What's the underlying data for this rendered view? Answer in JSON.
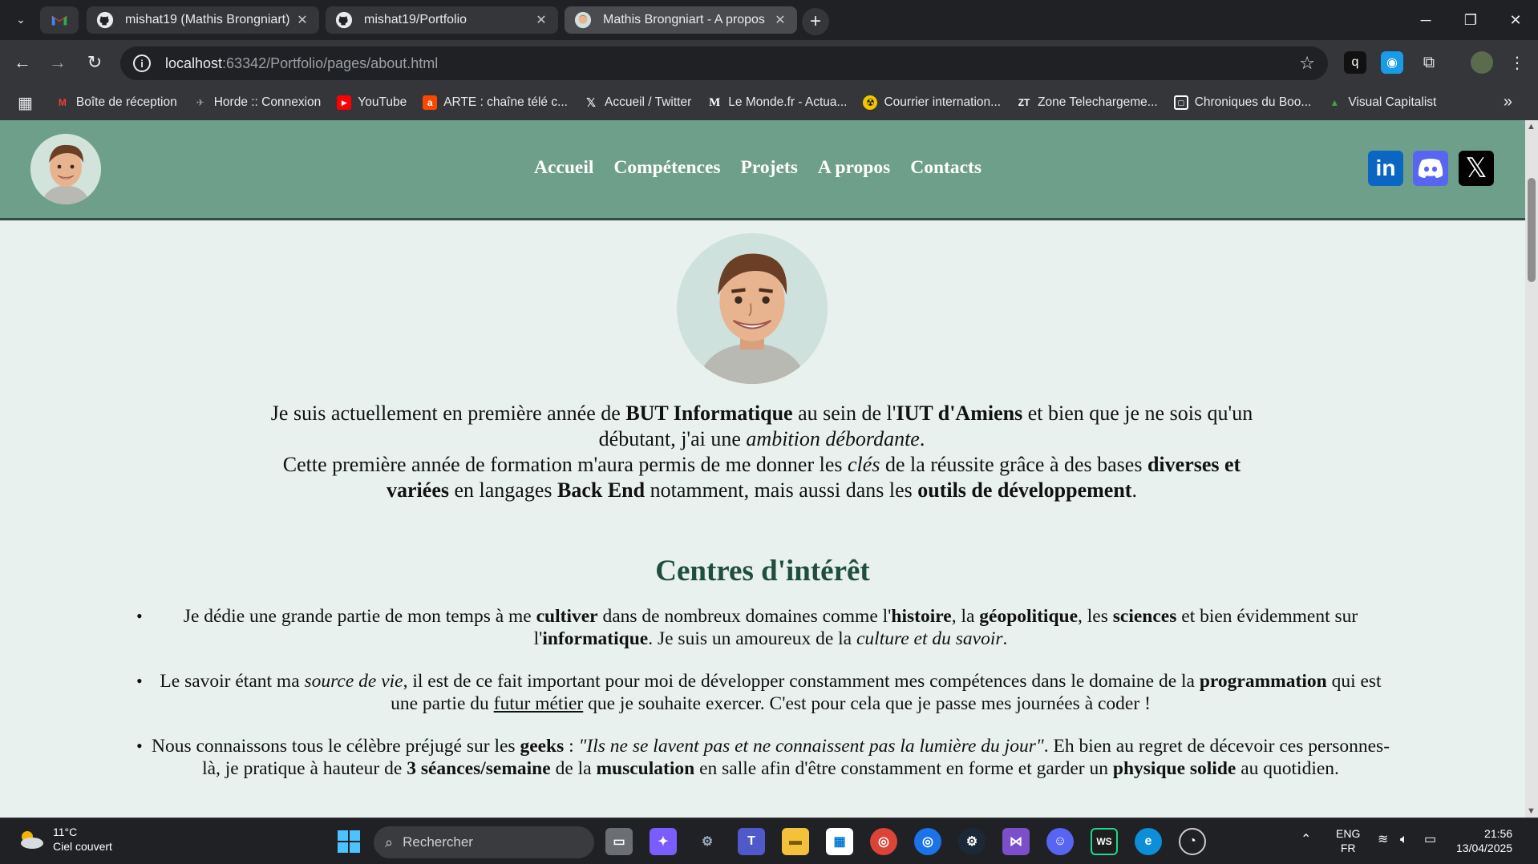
{
  "browser": {
    "tabs": [
      {
        "title": "mishat19 (Mathis Brongniart)",
        "close": "✕"
      },
      {
        "title": "mishat19/Portfolio",
        "close": "✕"
      },
      {
        "title": "Mathis Brongniart - A propos",
        "close": "✕"
      }
    ],
    "new_tab": "+",
    "url_host": "localhost",
    "url_path": ":63342/Portfolio/pages/about.html",
    "bookmarks": [
      {
        "label": "Boîte de réception",
        "icon": "gmail-icon",
        "color": "#ea4335"
      },
      {
        "label": "Horde :: Connexion",
        "icon": "horde-icon",
        "color": "#9aa0a6"
      },
      {
        "label": "YouTube",
        "icon": "youtube-icon",
        "color": "#ff0000"
      },
      {
        "label": "ARTE : chaîne télé c...",
        "icon": "arte-icon",
        "color": "#fd4600"
      },
      {
        "label": "Accueil / Twitter",
        "icon": "x-icon",
        "color": "#000000"
      },
      {
        "label": "Le Monde.fr - Actua...",
        "icon": "lemonde-icon",
        "color": "#000000"
      },
      {
        "label": "Courrier internation...",
        "icon": "courrier-icon",
        "color": "#f5c400"
      },
      {
        "label": "Zone Telechargeme...",
        "icon": "zt-icon",
        "color": "#35363a"
      },
      {
        "label": "Chroniques du Boo...",
        "icon": "chroniques-icon",
        "color": "#35363a"
      },
      {
        "label": "Visual Capitalist",
        "icon": "visualcapitalist-icon",
        "color": "#3fa14a"
      }
    ]
  },
  "site": {
    "nav": [
      "Accueil",
      "Compétences",
      "Projets",
      "A propos",
      "Contacts"
    ],
    "social": {
      "linkedin": "in",
      "x": "𝕏"
    },
    "intro": {
      "p1_a": "Je suis actuellement en première année de ",
      "p1_b": "BUT Informatique",
      "p1_c": " au sein de l'",
      "p1_d": "IUT d'Amiens",
      "p1_e": " et bien que je ne sois qu'un débutant, j'ai une ",
      "p1_f": "ambition débordante",
      "p1_g": ".",
      "p2_a": "Cette première année de formation m'aura permis de me donner les ",
      "p2_b": "clés",
      "p2_c": " de la réussite grâce à des bases ",
      "p2_d": "diverses et variées",
      "p2_e": " en langages ",
      "p2_f": "Back End",
      "p2_g": " notamment, mais aussi dans les ",
      "p2_h": "outils de développement",
      "p2_i": "."
    },
    "section_title": "Centres d'intérêt",
    "interests": {
      "i1": [
        "Je dédie une grande partie de mon temps à me ",
        "cultiver",
        " dans de nombreux domaines comme l'",
        "histoire",
        ", la ",
        "géopolitique",
        ", les ",
        "sciences",
        " et bien évidemment sur l'",
        "informatique",
        ". Je suis un amoureux de la ",
        "culture et du savoir",
        "."
      ],
      "i2": [
        "Le savoir étant ma ",
        "source de vie",
        ", il est de ce fait important pour moi de développer constamment mes compétences dans le domaine de la ",
        "programmation",
        " qui est une partie du ",
        "futur métier",
        " que je souhaite exercer. C'est pour cela que je passe mes journées à coder !"
      ],
      "i3": [
        "Nous connaissons tous le célèbre préjugé sur les ",
        "geeks",
        " : ",
        "\"Ils ne se lavent pas et ne connaissent pas la lumière du jour\"",
        ". Eh bien au regret de décevoir ces personnes-là, je pratique à hauteur de ",
        "3 séances/semaine",
        " de la ",
        "musculation",
        " en salle afin d'être constamment en forme et garder un ",
        "physique solide",
        " au quotidien."
      ]
    }
  },
  "taskbar": {
    "temp": "11°C",
    "weather": "Ciel couvert",
    "search_placeholder": "Rechercher",
    "lang_top": "ENG",
    "lang_bottom": "FR",
    "time": "21:56",
    "date": "13/04/2025"
  }
}
